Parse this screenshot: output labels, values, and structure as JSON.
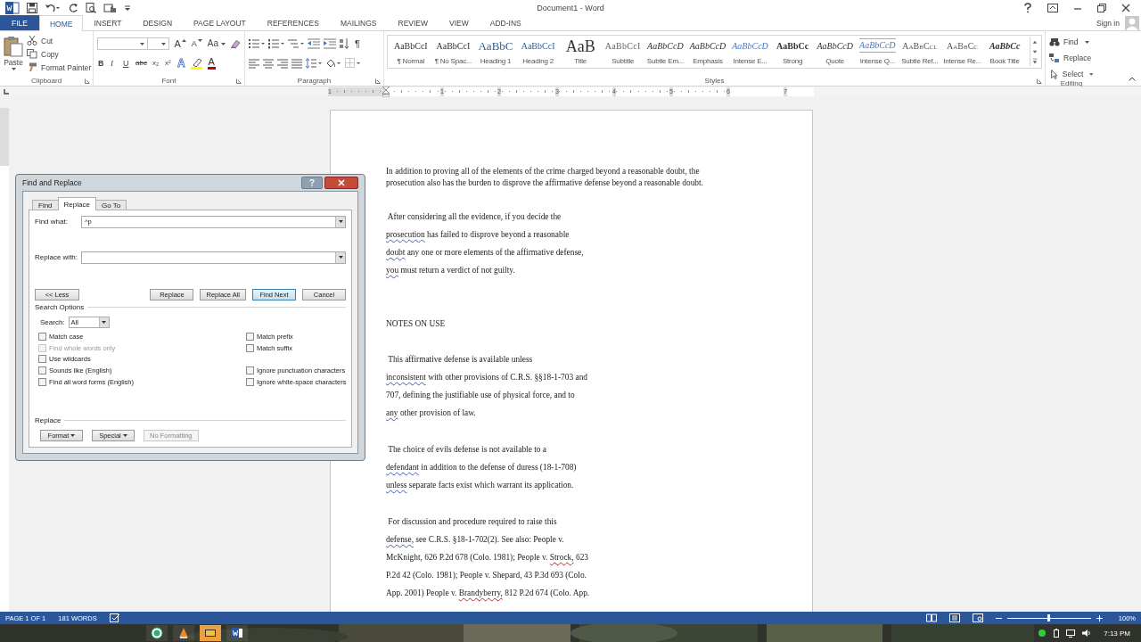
{
  "window": {
    "title": "Document1 - Word",
    "sign_in": "Sign in"
  },
  "ribbon_tabs": [
    {
      "label": "FILE",
      "kind": "file",
      "selected": false
    },
    {
      "label": "HOME",
      "kind": "tab",
      "selected": true
    },
    {
      "label": "INSERT",
      "kind": "tab",
      "selected": false
    },
    {
      "label": "DESIGN",
      "kind": "tab",
      "selected": false
    },
    {
      "label": "PAGE LAYOUT",
      "kind": "tab",
      "selected": false
    },
    {
      "label": "REFERENCES",
      "kind": "tab",
      "selected": false
    },
    {
      "label": "MAILINGS",
      "kind": "tab",
      "selected": false
    },
    {
      "label": "REVIEW",
      "kind": "tab",
      "selected": false
    },
    {
      "label": "VIEW",
      "kind": "tab",
      "selected": false
    },
    {
      "label": "ADD-INS",
      "kind": "tab",
      "selected": false
    }
  ],
  "clipboard": {
    "label": "Clipboard",
    "paste": "Paste",
    "cut": "Cut",
    "copy": "Copy",
    "format_painter": "Format Painter"
  },
  "font": {
    "label": "Font",
    "grow": "A",
    "shrink": "A",
    "change_case": "Aa",
    "format_buttons": [
      "B",
      "I",
      "U",
      "abc",
      "x₂",
      "x²"
    ],
    "effects": "A",
    "font_color_letter": "A"
  },
  "paragraph": {
    "label": "Paragraph",
    "show_marks": "¶"
  },
  "styles": {
    "label": "Styles",
    "items": [
      {
        "preview": "AaBbCcI",
        "name": "¶ Normal",
        "kind": "normal"
      },
      {
        "preview": "AaBbCcI",
        "name": "¶ No Spac...",
        "kind": "normal"
      },
      {
        "preview": "AaBbC",
        "name": "Heading 1",
        "kind": "heading1"
      },
      {
        "preview": "AaBbCcI",
        "name": "Heading 2",
        "kind": "heading2"
      },
      {
        "preview": "AaB",
        "name": "Title",
        "kind": "title"
      },
      {
        "preview": "AaBbCcI",
        "name": "Subtitle",
        "kind": "subtitle"
      },
      {
        "preview": "AaBbCcD",
        "name": "Subtle Em...",
        "kind": "italic"
      },
      {
        "preview": "AaBbCcD",
        "name": "Emphasis",
        "kind": "italic"
      },
      {
        "preview": "AaBbCcD",
        "name": "Intense E...",
        "kind": "intense"
      },
      {
        "preview": "AaBbCc",
        "name": "Strong",
        "kind": "strong"
      },
      {
        "preview": "AaBbCcD",
        "name": "Quote",
        "kind": "italic"
      },
      {
        "preview": "AaBbCcD",
        "name": "Intense Q...",
        "kind": "quote"
      },
      {
        "preview": "AaBbCcl",
        "name": "Subtle Ref...",
        "kind": "caps"
      },
      {
        "preview": "AaBbCc",
        "name": "Intense Re...",
        "kind": "caps"
      },
      {
        "preview": "AaBbCc",
        "name": "Book Title",
        "kind": "book"
      }
    ]
  },
  "editing": {
    "label": "Editing",
    "find": "Find",
    "replace": "Replace",
    "select": "Select"
  },
  "ruler": {
    "labels": [
      "1",
      "1",
      "2",
      "3",
      "4",
      "5",
      "6",
      "7"
    ]
  },
  "document": {
    "paragraphs": [
      {
        "kind": "tight",
        "lines": [
          [
            {
              "text": "In addition to proving all of the elements of the crime charged beyond a reasonable doubt, the",
              "kind": "plain"
            }
          ],
          [
            {
              "text": "prosecution also has the burden to disprove the affirmative defense beyond a reasonable doubt.",
              "kind": "plain"
            }
          ]
        ]
      },
      {
        "kind": "body",
        "lines": [
          [
            {
              "text": " After considering all the evidence, if you decide the",
              "kind": "plain"
            }
          ],
          [
            {
              "text": "prosecution",
              "kind": "grammar"
            },
            {
              "text": " has failed to disprove beyond a reasonable",
              "kind": "plain"
            }
          ],
          [
            {
              "text": "doubt",
              "kind": "grammar"
            },
            {
              "text": " any one or more elements of the affirmative defense,",
              "kind": "plain"
            }
          ],
          [
            {
              "text": "you",
              "kind": "grammar"
            },
            {
              "text": " must return a verdict of not guilty.",
              "kind": "plain"
            }
          ]
        ]
      },
      {
        "kind": "heading",
        "lines": [
          [
            {
              "text": "NOTES ON USE",
              "kind": "plain"
            }
          ]
        ]
      },
      {
        "kind": "body",
        "lines": [
          [
            {
              "text": " This affirmative defense is available unless",
              "kind": "plain"
            }
          ],
          [
            {
              "text": "inconsistent",
              "kind": "grammar"
            },
            {
              "text": " with other provisions of C.R.S. §§18-1-703 and",
              "kind": "plain"
            }
          ],
          [
            {
              "text": "707, defining the justifiable use of physical force, and to",
              "kind": "plain"
            }
          ],
          [
            {
              "text": "any",
              "kind": "grammar"
            },
            {
              "text": " other provision of law.",
              "kind": "plain"
            }
          ]
        ]
      },
      {
        "kind": "body",
        "lines": [
          [
            {
              "text": " The choice of evils defense is not available to a",
              "kind": "plain"
            }
          ],
          [
            {
              "text": "defendant",
              "kind": "grammar"
            },
            {
              "text": " in addition to the defense of duress (18-1-708)",
              "kind": "plain"
            }
          ],
          [
            {
              "text": "unless",
              "kind": "grammar"
            },
            {
              "text": " separate facts exist which warrant its application.",
              "kind": "plain"
            }
          ]
        ]
      },
      {
        "kind": "body",
        "lines": [
          [
            {
              "text": " For discussion and procedure required to raise this",
              "kind": "plain"
            }
          ],
          [
            {
              "text": "defense,",
              "kind": "grammar"
            },
            {
              "text": " see C.R.S. §18-1-702(2). See also: People v.",
              "kind": "plain"
            }
          ],
          [
            {
              "text": "McKnight, 626 P.2d 678 (Colo. 1981); People v. ",
              "kind": "plain"
            },
            {
              "text": "Strock,",
              "kind": "spelling"
            },
            {
              "text": " 623",
              "kind": "plain"
            }
          ],
          [
            {
              "text": "P.2d 42 (Colo. 1981); People v. Shepard, 43 P.3d 693 (Colo.",
              "kind": "plain"
            }
          ],
          [
            {
              "text": "App. 2001) People v. ",
              "kind": "plain"
            },
            {
              "text": "Brandyberry,",
              "kind": "spelling"
            },
            {
              "text": " 812 P.2d 674 (Colo. App.",
              "kind": "plain"
            }
          ]
        ]
      }
    ]
  },
  "dialog": {
    "title": "Find and Replace",
    "tabs": [
      {
        "label": "Find",
        "selected": false
      },
      {
        "label": "Replace",
        "selected": true
      },
      {
        "label": "Go To",
        "selected": false
      }
    ],
    "find_what": {
      "label": "Find what:",
      "value": "^p"
    },
    "replace_with": {
      "label": "Replace with:"
    },
    "less_button": "<< Less",
    "buttons": [
      {
        "label": "Replace",
        "focused": false
      },
      {
        "label": "Replace All",
        "focused": false
      },
      {
        "label": "Find Next",
        "focused": true
      },
      {
        "label": "Cancel",
        "focused": false
      }
    ],
    "search_options": {
      "label": "Search Options",
      "search_label": "Search:",
      "search_value": "All"
    },
    "options_left": [
      {
        "label": "Match case",
        "checked": false,
        "disabled": false
      },
      {
        "label": "Find whole words only",
        "checked": false,
        "disabled": true
      },
      {
        "label": "Use wildcards",
        "checked": false,
        "disabled": false
      },
      {
        "label": "Sounds like (English)",
        "checked": false,
        "disabled": false
      },
      {
        "label": "Find all word forms (English)",
        "checked": false,
        "disabled": false
      }
    ],
    "options_right": [
      {
        "label": "Match prefix",
        "checked": false,
        "disabled": false
      },
      {
        "label": "Match suffix",
        "checked": false,
        "disabled": false
      },
      {
        "label": "Ignore punctuation characters",
        "checked": false,
        "disabled": false
      },
      {
        "label": "Ignore white-space characters",
        "checked": false,
        "disabled": false
      }
    ],
    "replace_section": {
      "label": "Replace",
      "buttons": [
        {
          "label": "Format",
          "dropdown": true,
          "disabled": false
        },
        {
          "label": "Special",
          "dropdown": true,
          "disabled": false
        },
        {
          "label": "No Formatting",
          "dropdown": false,
          "disabled": true
        }
      ]
    }
  },
  "status_bar": {
    "page": "PAGE 1 OF 1",
    "words": "181 WORDS",
    "zoom": {
      "level": 0.5,
      "reading": "100%"
    }
  },
  "taskbar": {
    "clock": "7:13 PM"
  }
}
